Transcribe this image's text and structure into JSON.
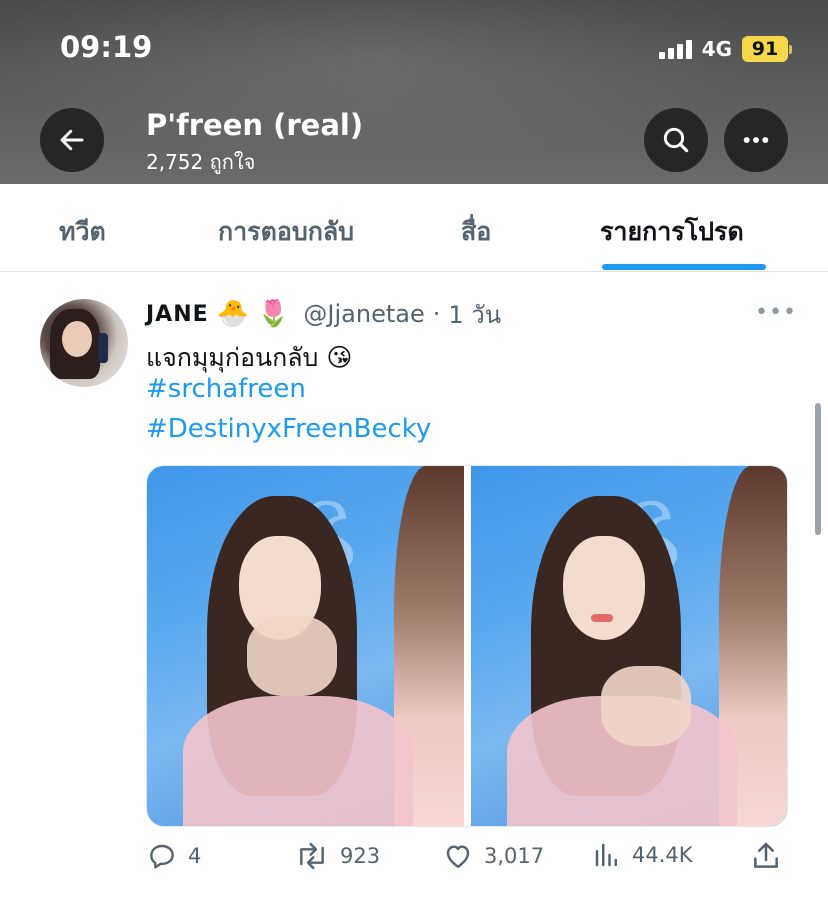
{
  "status_bar": {
    "time": "09:19",
    "network": "4G",
    "battery": "91",
    "battery_color": "#f5d84a"
  },
  "header": {
    "title": "P'freen (real)",
    "subtitle": "2,752 ถูกใจ",
    "back_icon": "arrow-left-icon",
    "search_icon": "search-icon",
    "more_icon": "more-horizontal-icon"
  },
  "tabs": [
    {
      "label": "ทวีต",
      "active": false
    },
    {
      "label": "การตอบกลับ",
      "active": false
    },
    {
      "label": "สื่อ",
      "active": false
    },
    {
      "label": "รายการโปรด",
      "active": true
    }
  ],
  "accent_color": "#1d9bf0",
  "tweet": {
    "display_name": "JANE",
    "name_emojis": [
      "🐣",
      "🌷"
    ],
    "handle": "@Jjanetae",
    "separator": "·",
    "time": "1 วัน",
    "text": "แจกมุมุก่อนกลับ 😘",
    "hashtags": [
      "#srchafreen",
      "#DestinyxFreenBecky"
    ],
    "media_count": 2,
    "actions": {
      "replies": "4",
      "retweets": "923",
      "likes": "3,017",
      "views": "44.4K"
    }
  }
}
